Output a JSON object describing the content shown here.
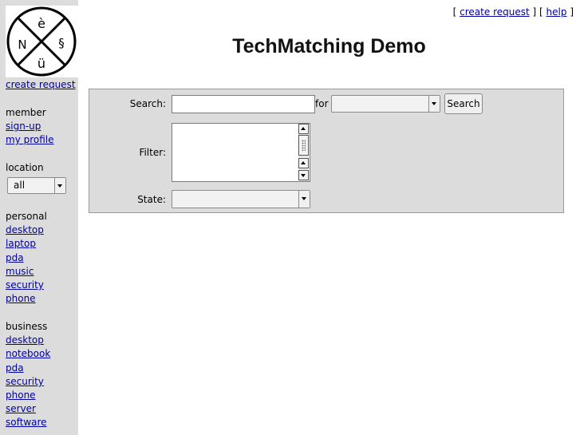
{
  "header": {
    "title": "TechMatching Demo",
    "links": {
      "open_bracket_1": "[",
      "create_request": "create request",
      "close_open_bracket": "] [",
      "help": "help",
      "close_bracket_2": "]"
    }
  },
  "logo": {
    "letters": [
      "è",
      "§",
      "N",
      "ü"
    ]
  },
  "sidebar": {
    "create_request": "create request",
    "member": {
      "heading": "member",
      "links": [
        "sign-up",
        "my profile"
      ]
    },
    "location": {
      "heading": "location",
      "selected": "all"
    },
    "personal": {
      "heading": "personal",
      "links": [
        "desktop",
        "laptop",
        "pda",
        "music",
        "security",
        "phone"
      ]
    },
    "business": {
      "heading": "business",
      "links": [
        "desktop",
        "notebook",
        "pda",
        "security",
        "phone",
        "server",
        "software"
      ]
    }
  },
  "form": {
    "search_label": "Search:",
    "search_value": "",
    "for_label": "for",
    "for_selected": "",
    "search_button": "Search",
    "filter_label": "Filter:",
    "state_label": "State:",
    "state_selected": ""
  }
}
